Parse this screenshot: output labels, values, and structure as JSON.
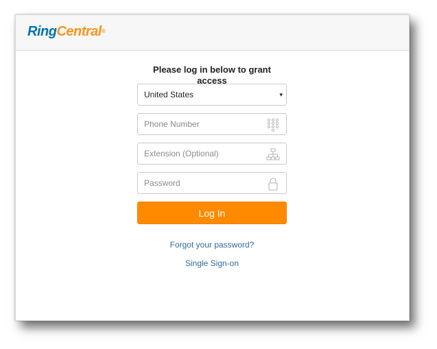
{
  "brand": {
    "logo_ring": "Ring",
    "logo_central": "Central",
    "logo_reg": "®",
    "colors": {
      "blue": "#0073ae",
      "orange": "#f7941d",
      "button": "#ff8a00",
      "link": "#2c6d9c"
    }
  },
  "form": {
    "prompt": "Please log in below to grant access",
    "country": {
      "selected": "United States",
      "caret": "▾"
    },
    "phone": {
      "placeholder": "Phone Number",
      "value": "",
      "icon": "keypad-icon"
    },
    "extension": {
      "placeholder": "Extension (Optional)",
      "value": "",
      "icon": "org-chart-icon"
    },
    "password": {
      "placeholder": "Password",
      "value": "",
      "icon": "lock-icon"
    },
    "login_label": "Log In"
  },
  "links": {
    "forgot": "Forgot your password?",
    "sso": "Single Sign-on"
  }
}
